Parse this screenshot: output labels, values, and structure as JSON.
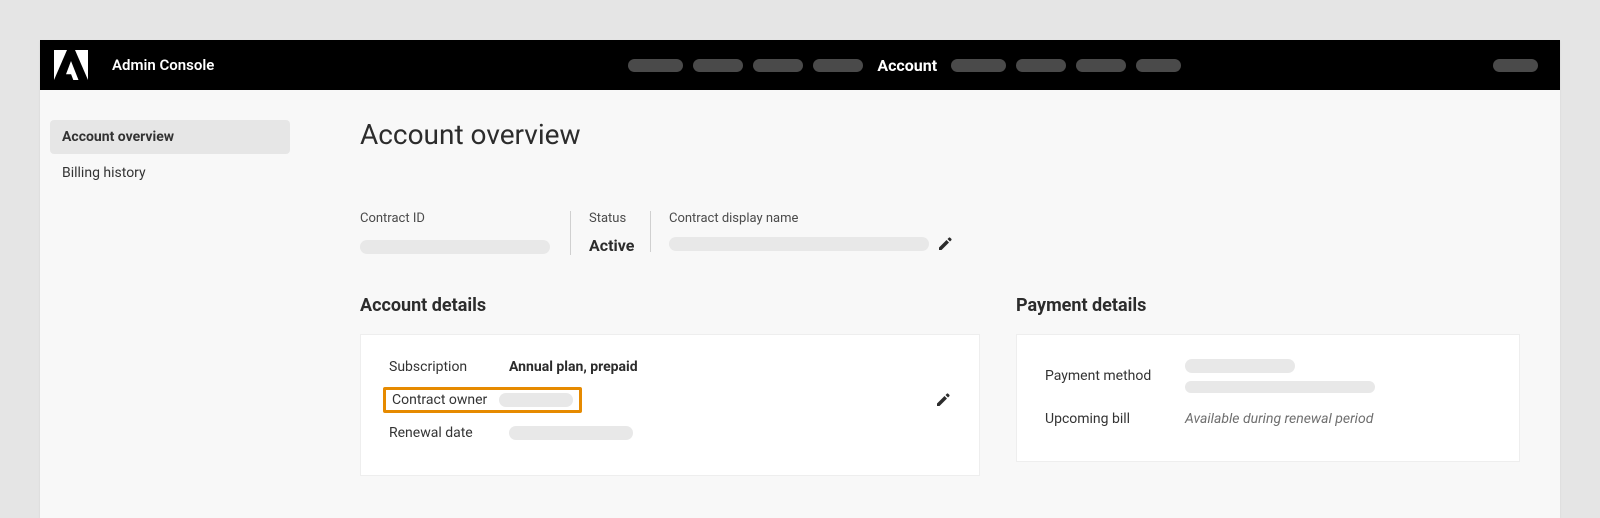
{
  "header": {
    "app_title": "Admin Console",
    "active_tab": "Account"
  },
  "sidebar": {
    "items": [
      {
        "label": "Account overview",
        "active": true
      },
      {
        "label": "Billing history",
        "active": false
      }
    ]
  },
  "page": {
    "title": "Account overview",
    "contract": {
      "contract_id_label": "Contract ID",
      "status_label": "Status",
      "status_value": "Active",
      "display_name_label": "Contract display name"
    },
    "account_details": {
      "section_title": "Account details",
      "subscription_label": "Subscription",
      "subscription_value": "Annual plan, prepaid",
      "contract_owner_label": "Contract owner",
      "renewal_date_label": "Renewal date"
    },
    "payment_details": {
      "section_title": "Payment details",
      "payment_method_label": "Payment method",
      "upcoming_bill_label": "Upcoming bill",
      "upcoming_bill_value": "Available during renewal period"
    }
  }
}
